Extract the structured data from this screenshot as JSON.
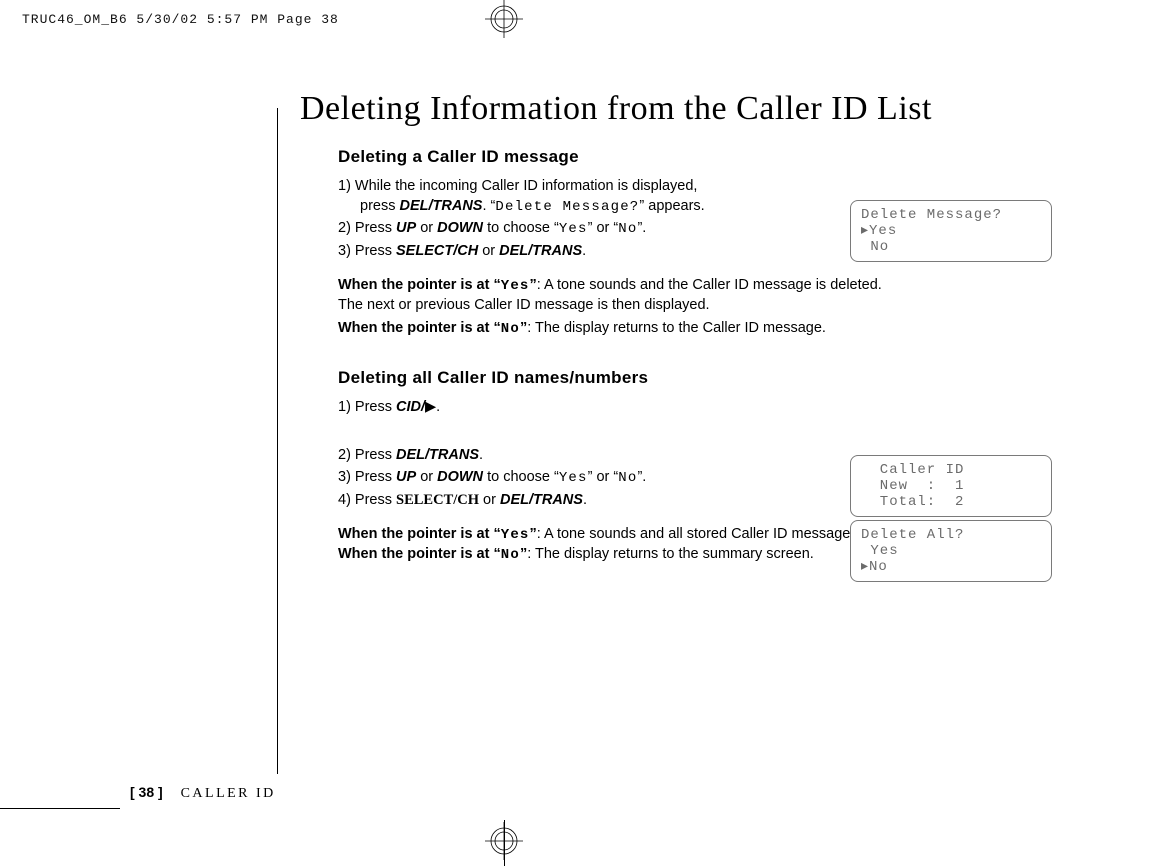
{
  "printer_slug": "TRUC46_OM_B6  5/30/02  5:57 PM  Page 38",
  "title": "Deleting Information from the Caller ID List",
  "section1": {
    "heading": "Deleting a Caller ID message",
    "step1a": "1) While the incoming Caller ID information is displayed,",
    "step1b_pre": "press ",
    "step1b_key": "DEL/TRANS",
    "step1b_mid": ". “",
    "step1b_lcd": "Delete Message?",
    "step1b_post": "” appears.",
    "step2_pre": "2) Press ",
    "step2_up": "UP",
    "step2_or1": " or ",
    "step2_down": "DOWN",
    "step2_mid": " to choose “",
    "step2_yes": "Yes",
    "step2_mid2": "” or “",
    "step2_no": "No",
    "step2_post": "”.",
    "step3_pre": "3) Press ",
    "step3_key1": "SELECT/CH",
    "step3_or": " or ",
    "step3_key2": "DEL/TRANS",
    "step3_post": ".",
    "res_yes_lead": "When the pointer is at “",
    "res_yes_val": "Yes",
    "res_yes_tail": "”",
    "res_yes_body": ": A tone sounds and the Caller ID message is deleted.",
    "res_yes_body2": "The next or previous Caller ID message is then displayed.",
    "res_no_lead": "When the pointer is at “",
    "res_no_val": "No",
    "res_no_tail": "”",
    "res_no_body": ": The display returns to the Caller ID message."
  },
  "section2": {
    "heading": "Deleting all Caller ID names/numbers",
    "step1_pre": "1) Press ",
    "step1_key": "CID/",
    "step1_arrow": "▶",
    "step1_post": ".",
    "step2_pre": "2) Press ",
    "step2_key": "DEL/TRANS",
    "step2_post": ".",
    "step3_pre": "3) Press ",
    "step3_up": "UP",
    "step3_or1": " or ",
    "step3_down": "DOWN",
    "step3_mid": " to choose “",
    "step3_yes": "Yes",
    "step3_mid2": "” or “",
    "step3_no": "No",
    "step3_post": "”.",
    "step4_pre": "4) Press ",
    "step4_key1": "SELECT/CH",
    "step4_or": " or ",
    "step4_key2": "DEL/TRANS",
    "step4_post": ".",
    "res_yes_lead": "When the pointer is at “",
    "res_yes_val": "Yes",
    "res_yes_tail": "”",
    "res_yes_body": ": A tone sounds and all stored Caller ID messages are deleted.",
    "res_no_lead": "When the pointer is at “",
    "res_no_val": "No",
    "res_no_tail": "”",
    "res_no_body": ": The display returns to the summary screen."
  },
  "lcd1": {
    "l1": "Delete Message?",
    "l2": "▸Yes",
    "l3": " No"
  },
  "lcd2": {
    "l1": "  Caller ID",
    "l2": "  New  :  1",
    "l3": "  Total:  2"
  },
  "lcd3": {
    "l1": "Delete All?",
    "l2": " Yes",
    "l3": "▸No"
  },
  "footer": {
    "page": "[ 38 ]",
    "section": "CALLER ID"
  }
}
